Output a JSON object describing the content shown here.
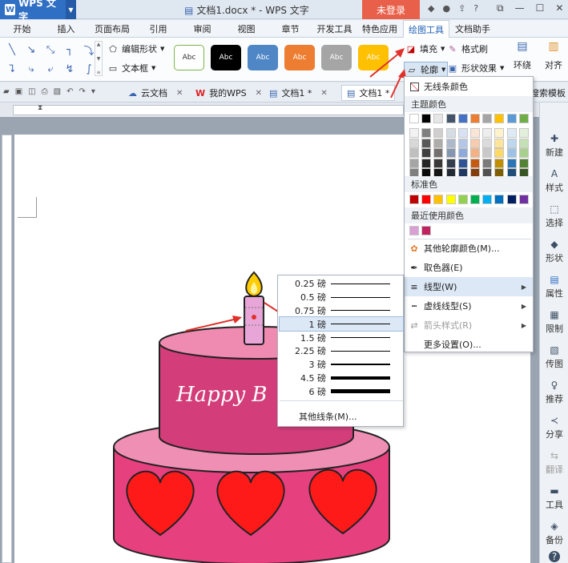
{
  "titlebar": {
    "app_button": "WPS 文字",
    "doc_title": "文档1.docx * - WPS 文字",
    "login_button": "未登录"
  },
  "ribbon_tabs": [
    {
      "label": "开始",
      "active": false
    },
    {
      "label": "插入",
      "active": false
    },
    {
      "label": "页面布局",
      "active": false
    },
    {
      "label": "引用",
      "active": false
    },
    {
      "label": "审阅",
      "active": false
    },
    {
      "label": "视图",
      "active": false
    },
    {
      "label": "章节",
      "active": false
    },
    {
      "label": "开发工具",
      "active": false
    },
    {
      "label": "特色应用",
      "active": false
    },
    {
      "label": "绘图工具",
      "active": true
    },
    {
      "label": "文档助手",
      "active": false
    }
  ],
  "ribbon": {
    "edit_shape": "编辑形状",
    "text_box": "文本框",
    "style_label": "Abc",
    "fill": "填充",
    "format_painter": "格式刷",
    "outline": "轮廓",
    "shape_effect": "形状效果",
    "wrap": "环绕",
    "align": "对齐"
  },
  "style_colors": [
    "#ffffff",
    "#000000",
    "#4f86c6",
    "#ed7d31",
    "#a5a5a5",
    "#ffc000"
  ],
  "doc_tabs": {
    "cloud": "云文档",
    "my_wps": "我的WPS",
    "doc1": "文档1 *",
    "doc2": "文档1 *",
    "search_templates": "搜索模板"
  },
  "side_panel": [
    "新建",
    "样式",
    "选择",
    "形状",
    "属性",
    "限制",
    "传图",
    "推荐",
    "分享",
    "翻译",
    "工具",
    "备份"
  ],
  "outline_menu": {
    "no_line": "无线条颜色",
    "theme_colors": "主题颜色",
    "standard_colors": "标准色",
    "recent_colors": "最近使用颜色",
    "more_colors": "其他轮廓颜色(M)...",
    "eyedropper": "取色器(E)",
    "line_type": "线型(W)",
    "dash_type": "虚线线型(S)",
    "arrow_style": "箭头样式(R)",
    "more_settings": "更多设置(O)..."
  },
  "theme_top_row": [
    "#ffffff",
    "#000000",
    "#e7e6e6",
    "#44546a",
    "#4472c4",
    "#ed7d31",
    "#a5a5a5",
    "#ffc000",
    "#5b9bd5",
    "#70ad47"
  ],
  "theme_shades": [
    [
      "#f2f2f2",
      "#7f7f7f",
      "#d0cece",
      "#d6dce4",
      "#d9e2f3",
      "#fbe5d6",
      "#ededed",
      "#fff2cc",
      "#deebf6",
      "#e2efd9"
    ],
    [
      "#d8d8d8",
      "#595959",
      "#aeabab",
      "#adb9ca",
      "#b4c6e7",
      "#f7cbac",
      "#dbdbdb",
      "#ffe599",
      "#bdd7ee",
      "#c5e0b3"
    ],
    [
      "#bfbfbf",
      "#3f3f3f",
      "#757070",
      "#8496b0",
      "#8eaadb",
      "#f4b183",
      "#c9c9c9",
      "#ffd965",
      "#9cc3e5",
      "#a8d08d"
    ],
    [
      "#a5a5a5",
      "#262626",
      "#3a3838",
      "#333f4f",
      "#2f5496",
      "#c55a11",
      "#7b7b7b",
      "#bf8f00",
      "#2e75b5",
      "#538135"
    ],
    [
      "#7f7f7f",
      "#0c0c0c",
      "#171616",
      "#222a35",
      "#1f3864",
      "#833c0b",
      "#525252",
      "#7f6000",
      "#1e4e79",
      "#375623"
    ]
  ],
  "standard_colors": [
    "#c00000",
    "#ff0000",
    "#ffc000",
    "#ffff00",
    "#92d050",
    "#00b050",
    "#00b0f0",
    "#0070c0",
    "#002060",
    "#7030a0"
  ],
  "recent_colors": [
    "#d9a0d6",
    "#c0245f"
  ],
  "line_weight_menu": {
    "weights": [
      {
        "label": "0.25 磅",
        "value": 0.25
      },
      {
        "label": "0.5 磅",
        "value": 0.5
      },
      {
        "label": "0.75 磅",
        "value": 0.75
      },
      {
        "label": "1 磅",
        "value": 1
      },
      {
        "label": "1.5 磅",
        "value": 1.5
      },
      {
        "label": "2.25 磅",
        "value": 2.25
      },
      {
        "label": "3 磅",
        "value": 3
      },
      {
        "label": "4.5 磅",
        "value": 4.5
      },
      {
        "label": "6 磅",
        "value": 6
      }
    ],
    "selected": "1 磅",
    "other_lines": "其他线条(M)..."
  },
  "cake": {
    "text": "Happy B",
    "top_color": "#d33d7a",
    "bottom_color": "#e6407f",
    "heart_color": "#ff1a1a"
  }
}
